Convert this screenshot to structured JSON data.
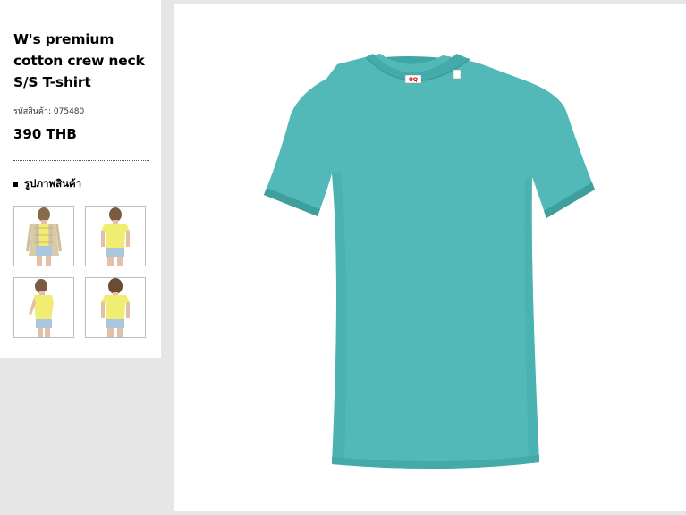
{
  "product": {
    "title": "W's premium cotton crew neck S/S T-shirt",
    "code_label": "รหัสสินค้า:",
    "code_value": "075480",
    "price": "390 THB"
  },
  "gallery": {
    "heading": "รูปภาพสินค้า",
    "thumbnails": [
      {
        "icon": "model-plaid-shirt-yellow-tee"
      },
      {
        "icon": "model-yellow-tee-front"
      },
      {
        "icon": "model-yellow-tee-side"
      },
      {
        "icon": "model-yellow-tee-back"
      }
    ]
  },
  "main_image": {
    "icon": "teal-crew-neck-tshirt",
    "shirt_color": "#52b9b8",
    "label_text": "UQ"
  },
  "colors": {
    "background": "#e6e6e6",
    "panel": "#ffffff",
    "thumb_tee": "#f1ec72",
    "thumb_shorts": "#a9c6de"
  }
}
